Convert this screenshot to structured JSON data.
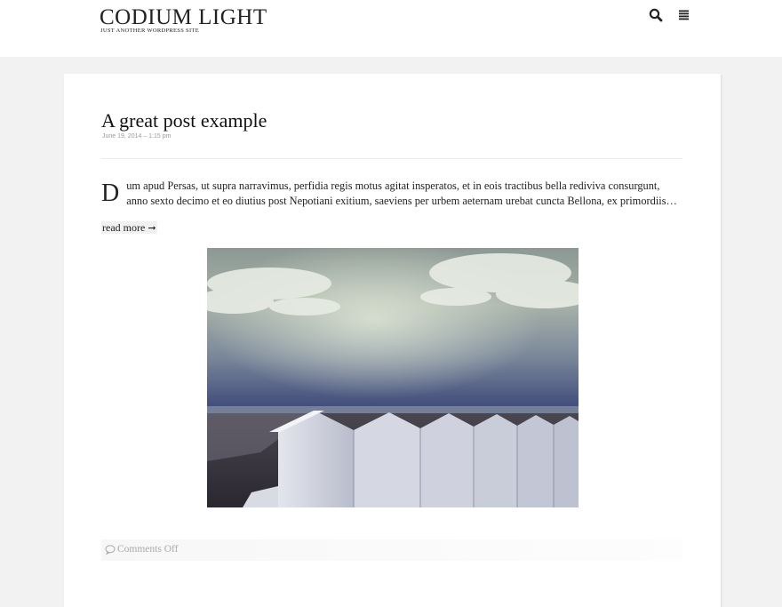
{
  "header": {
    "site_title": "CODIUM LIGHT",
    "tagline": "JUST ANOTHER WORDPRESS SITE",
    "icons": [
      "search-icon",
      "menu-icon"
    ]
  },
  "post": {
    "title": "A great post example",
    "date": "June 19, 2014 – 1:15 pm",
    "dropcap": "D",
    "excerpt": "um apud Persas, ut supra narravimus, perfidia regis motus agitat insperatos, et in eois tractibus bella rediviva consurgunt, anno sexto decimo et eo diutius post Nepotiani exitium, saeviens per urbem aeternam urebat cuncta Bellona, ex primordiis…",
    "read_more": "read more",
    "comments": "Comments Off"
  },
  "colors": {
    "page_background": "#f2f2f2",
    "card_background": "#ffffff",
    "text": "#222222",
    "muted_text": "#aaaaaa"
  }
}
